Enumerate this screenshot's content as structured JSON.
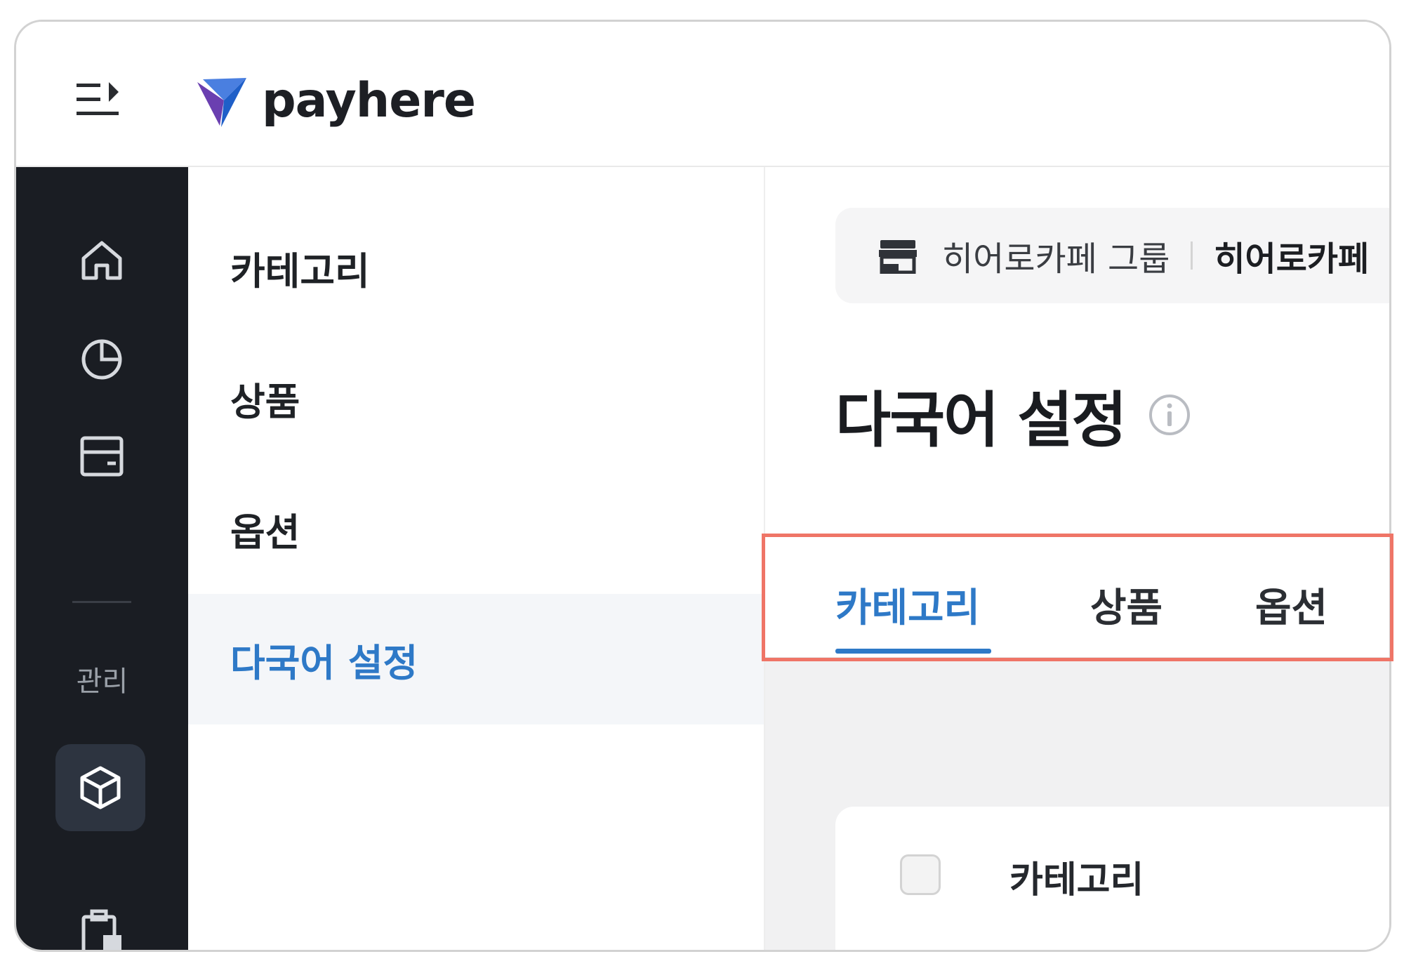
{
  "app": {
    "logo_text": "payhere",
    "brand_color": "#2e79c7"
  },
  "rail": {
    "section_label": "관리"
  },
  "submenu": {
    "items": [
      {
        "label": "카테고리"
      },
      {
        "label": "상품"
      },
      {
        "label": "옵션"
      },
      {
        "label": "다국어 설정"
      }
    ],
    "active_index": 3
  },
  "store": {
    "group": "히어로카페 그룹",
    "name": "히어로카페"
  },
  "page": {
    "title": "다국어 설정"
  },
  "tabs": {
    "items": [
      {
        "label": "카테고리"
      },
      {
        "label": "상품"
      },
      {
        "label": "옵션"
      }
    ],
    "active_index": 0
  },
  "table": {
    "column_header": "카테고리"
  },
  "icons": [
    "menu-collapse-icon",
    "home-icon",
    "chart-pie-icon",
    "card-icon",
    "box-icon",
    "clipboard-icon",
    "store-icon",
    "info-icon"
  ]
}
